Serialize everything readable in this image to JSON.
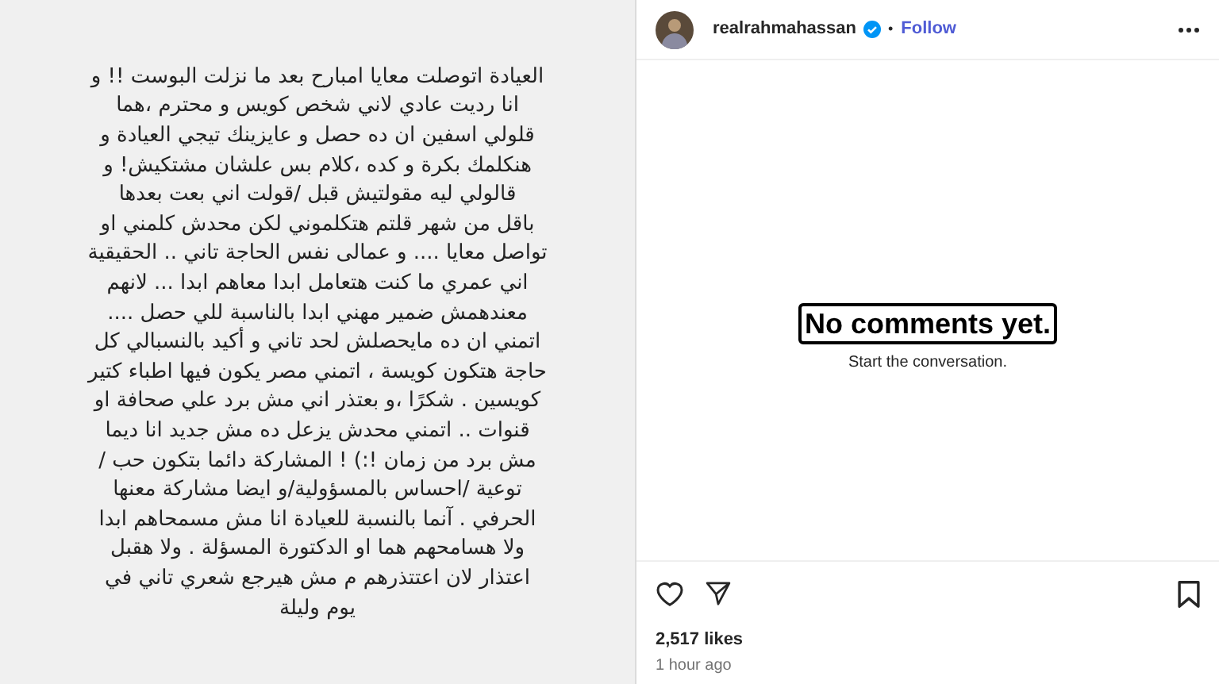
{
  "post_image": {
    "lines": [
      "العيادة اتوصلت معايا امبارح بعد ما نزلت البوست !! و",
      "انا رديت عادي لاني شخص كويس و محترم ،هما",
      "قلولي اسفين ان ده حصل و عايزينك تيجي العيادة و",
      "هنكلمك بكرة و كده ،كلام بس علشان مشتكيش! و",
      "قالولي ليه مقولتيش قبل /قولت اني بعت بعدها",
      "باقل من شهر قلتم هتكلموني لكن محدش كلمني او",
      "تواصل معايا .... و عمالى نفس الحاجة تاني .. الحقيقية",
      "اني عمري ما كنت هتعامل ابدا معاهم ابدا ... لانهم",
      "معندهمش ضمير مهني ابدا بالناسبة للي حصل ....",
      "اتمني ان ده مايحصلش لحد تاني و أكيد بالنسبالي كل",
      "حاجة هتكون كويسة ، اتمني مصر يكون فيها اطباء كتير",
      "كويسين . شكرًا ،و بعتذر اني مش برد علي صحافة او",
      "قنوات .. اتمني محدش يزعل ده مش جديد انا ديما",
      "مش برد من زمان !:) ! المشاركة دائما بتكون حب /",
      "توعية /احساس بالمسؤولية/و ايضا مشاركة معنها",
      "الحرفي . آنما بالنسبة للعيادة انا مش مسمحاهم ابدا",
      "ولا هسامحهم هما او الدكتورة المسؤلة . ولا هقبل",
      "اعتذار لان اعتتذرهم م مش هيرجع شعري تاني في",
      "يوم وليلة"
    ]
  },
  "header": {
    "username": "realrahmahassan",
    "verified": true,
    "separator": "•",
    "follow": "Follow"
  },
  "comments": {
    "empty_title": "No comments yet.",
    "empty_subtitle": "Start the conversation."
  },
  "actions": {
    "liked": false,
    "saved": false
  },
  "likes": "2,517 likes",
  "time": "1 hour ago"
}
